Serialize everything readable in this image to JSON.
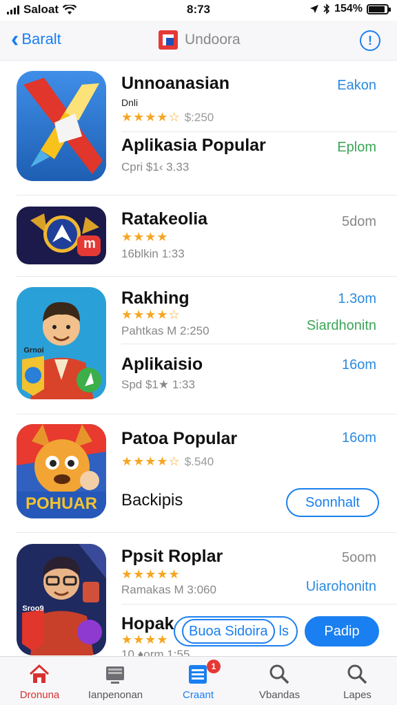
{
  "status_bar": {
    "carrier": "Saloat",
    "time": "8:73",
    "battery": "154%",
    "battery_level": 0.9
  },
  "nav": {
    "back_label": "Baralt",
    "title": "Undoora",
    "info_glyph": "!"
  },
  "apps": [
    {
      "title": "Unnoanasian",
      "subtitle": "Dnli",
      "stars": "★★★★☆",
      "rating_text": "$:250",
      "action": "Eakon",
      "action_color": "blue"
    },
    {
      "title": "Aplikasia Popular",
      "subtitle": "Cpri $1‹ 3.33",
      "action": "Eplom",
      "action_color": "green"
    },
    {
      "title": "Ratakeolia",
      "stars": "★★★★",
      "subtitle": "16blkin 1:33",
      "action": "5dom",
      "action_color": "grey"
    },
    {
      "title": "Rakhing",
      "stars": "★★★★☆",
      "subtitle": "Pahtkas M 2:250",
      "action": "1.3om",
      "action2": "Siardhonitn",
      "action_color": "blue"
    },
    {
      "title": "Aplikaisio",
      "subtitle": "Spd $1★ 1:33",
      "action": "16om",
      "action_color": "blue"
    },
    {
      "title": "Patoa Popular",
      "stars": "★★★★☆",
      "rating_text": "$.540",
      "action": "16om",
      "subtitle": "Backipis",
      "pill": "Sonnhalt"
    },
    {
      "title": "Ppsit Roplar",
      "stars": "★★★★★",
      "subtitle": "Ramakas M 3:060",
      "action": "5oom",
      "action2": "Uiarohonitn"
    },
    {
      "title": "Hopak",
      "stars": "★★★★",
      "subtitle": "10 ♦orm 1:55",
      "pill_outline": "Buoa Sidoira",
      "pill_outline_tail": "ls",
      "pill_solid": "Padip"
    }
  ],
  "icon_labels": {
    "icon2": "m",
    "icon3": "Grnoi",
    "icon4": "POHUAR",
    "icon5": "Sroo9"
  },
  "tabs": [
    {
      "label": "Dronuna",
      "icon": "home-icon"
    },
    {
      "label": "Ianpenonan",
      "icon": "tv-icon"
    },
    {
      "label": "Craant",
      "icon": "list-icon",
      "badge": "1"
    },
    {
      "label": "Vbandas",
      "icon": "search-icon"
    },
    {
      "label": "Lapes",
      "icon": "search-icon"
    }
  ],
  "colors": {
    "accent": "#1a7ff0",
    "green": "#3aa556",
    "star": "#f5a623",
    "red": "#e53935"
  }
}
